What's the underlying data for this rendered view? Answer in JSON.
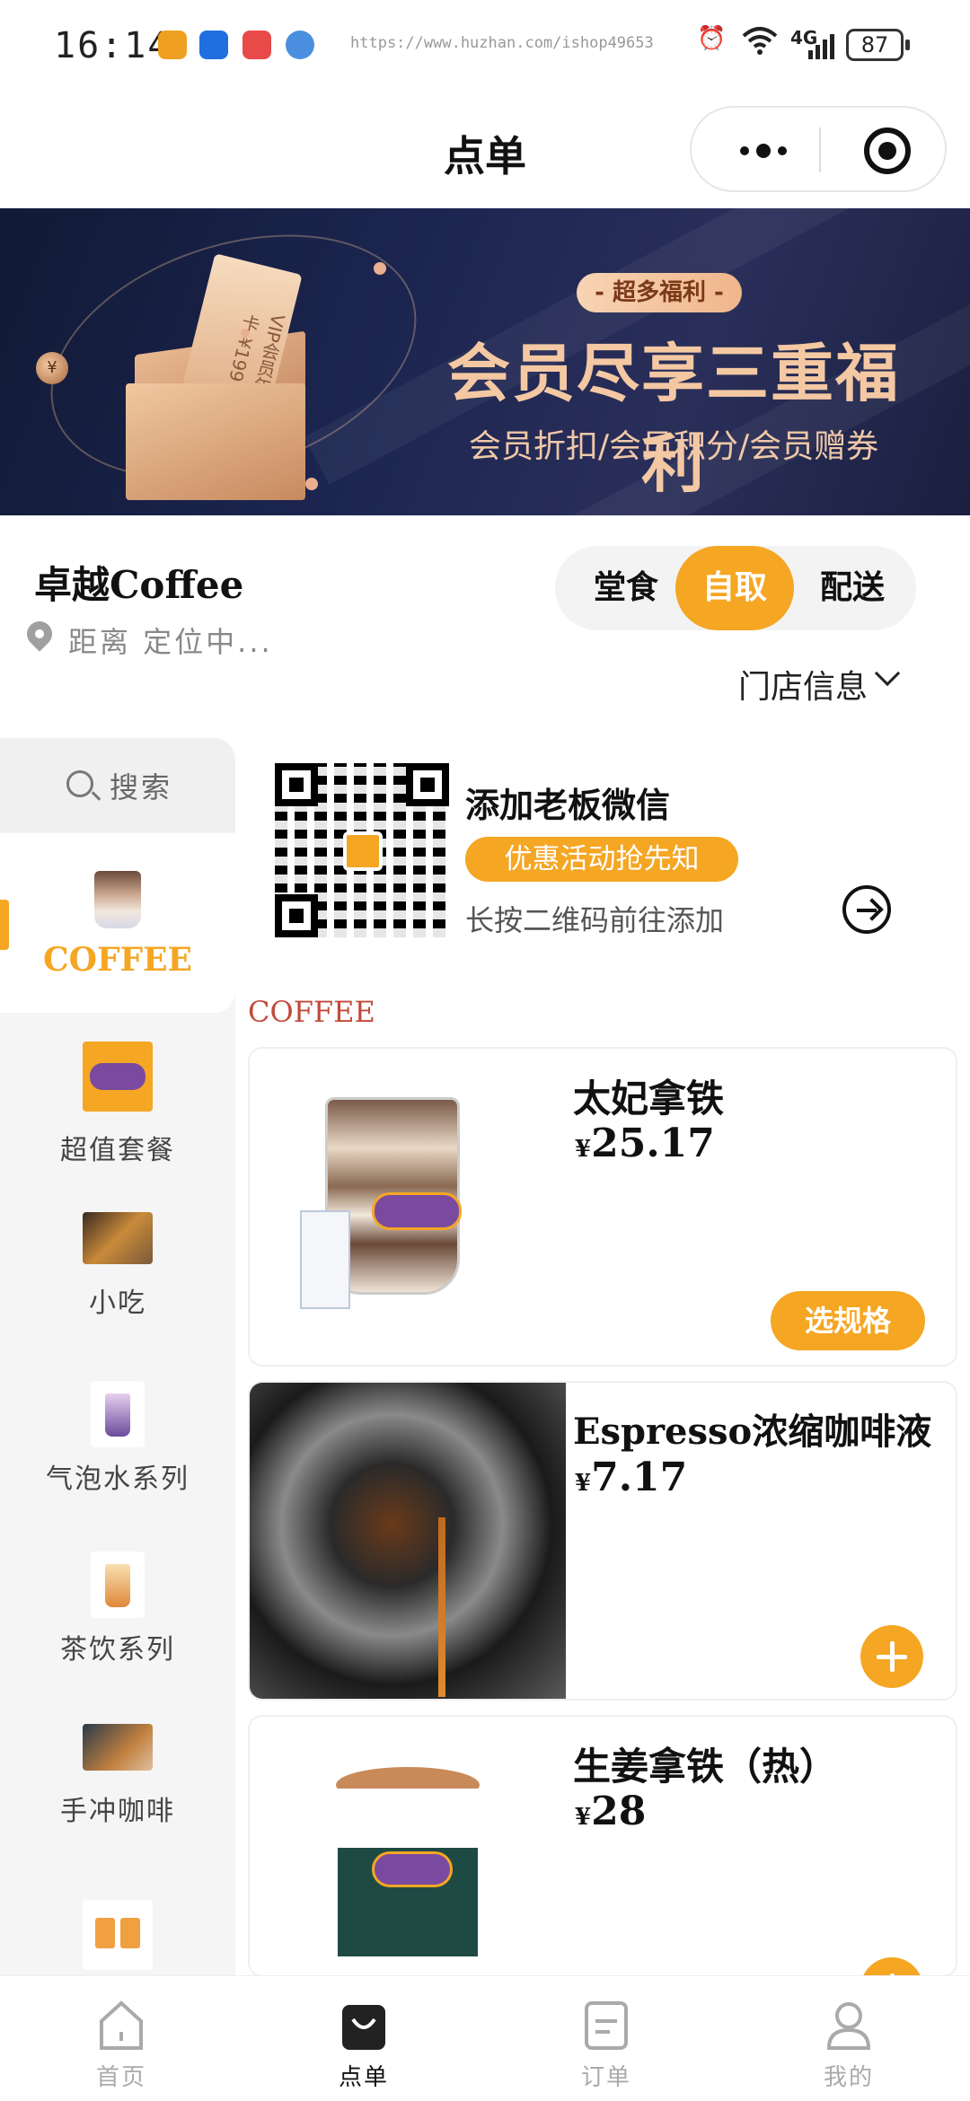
{
  "status_bar": {
    "time": "16:14",
    "url": "https://www.huzhan.com/ishop49653",
    "network": "4G",
    "battery": "87"
  },
  "title_bar": {
    "title": "点单",
    "more_icon": "more-dots-icon",
    "close_icon": "target-close-icon"
  },
  "banner": {
    "tag": "- 超多福利 -",
    "title": "会员尽享三重福利",
    "subtitle": "会员折扣/会员积分/会员赠券",
    "card_text": "VIP会员年卡 ¥199",
    "coin_text": "¥"
  },
  "shop": {
    "name": "卓越Coffee",
    "location": "距离 定位中...",
    "modes": [
      "堂食",
      "自取",
      "配送"
    ],
    "active_mode": "自取",
    "store_info": "门店信息"
  },
  "sidebar": {
    "search_label": "搜索",
    "categories": [
      {
        "label": "COFFEE",
        "active": true
      },
      {
        "label": "超值套餐",
        "active": false
      },
      {
        "label": "小吃",
        "active": false
      },
      {
        "label": "气泡水系列",
        "active": false
      },
      {
        "label": "茶饮系列",
        "active": false
      },
      {
        "label": "手冲咖啡",
        "active": false
      }
    ]
  },
  "promo": {
    "title": "添加老板微信",
    "tag": "优惠活动抢先知",
    "desc": "长按二维码前往添加"
  },
  "section_title": "COFFEE",
  "products": [
    {
      "name": "太妃拿铁",
      "currency": "¥",
      "price": "25.17",
      "action": "选规格"
    },
    {
      "name": "Espresso浓缩咖啡液",
      "currency": "¥",
      "price": "7.17",
      "action": "+"
    },
    {
      "name": "生姜拿铁（热）",
      "currency": "¥",
      "price": "28",
      "action": "+"
    }
  ],
  "tabbar": [
    {
      "label": "首页",
      "icon": "home-icon",
      "active": false
    },
    {
      "label": "点单",
      "icon": "shopping-bag-icon",
      "active": true
    },
    {
      "label": "订单",
      "icon": "order-doc-icon",
      "active": false
    },
    {
      "label": "我的",
      "icon": "user-icon",
      "active": false
    }
  ],
  "colors": {
    "accent": "#f5a623",
    "section_title": "#c14a3a",
    "banner_bg": "#1c2550"
  }
}
